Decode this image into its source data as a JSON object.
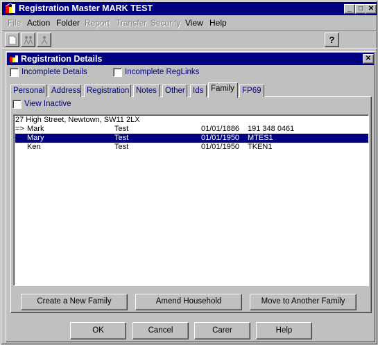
{
  "window": {
    "title": "Registration Master MARK TEST"
  },
  "menu": {
    "items": [
      "File",
      "Action",
      "Folder",
      "Report",
      "Transfer",
      "Security",
      "View",
      "Help"
    ]
  },
  "toolbar": {
    "icons": [
      "new-document-icon",
      "people-icon",
      "person-icon",
      "question-mark-icon"
    ]
  },
  "dialog": {
    "title": "Registration Details",
    "incomplete_details_label": "Incomplete Details",
    "incomplete_reglinks_label": "Incomplete RegLinks",
    "tabs": [
      "Personal",
      "Address",
      "Registration",
      "Notes",
      "Other",
      "Ids",
      "Family",
      "FP69"
    ],
    "active_tab": "Family",
    "view_inactive_label": "View Inactive",
    "family": {
      "address": "27 High Street, Newtown, SW11 2LX",
      "members": [
        {
          "marker": "=>",
          "first": "Mark",
          "last": "Test",
          "dob": "01/01/1886",
          "id": "191 348 0461",
          "selected": false
        },
        {
          "marker": "",
          "first": "Mary",
          "last": "Test",
          "dob": "01/01/1950",
          "id": "MTES1",
          "selected": true
        },
        {
          "marker": "",
          "first": "Ken",
          "last": "Test",
          "dob": "01/01/1950",
          "id": "TKEN1",
          "selected": false
        }
      ]
    },
    "buttons": {
      "create_family": "Create a New Family",
      "amend_household": "Amend Household",
      "move_family": "Move to Another Family",
      "ok": "OK",
      "cancel": "Cancel",
      "carer": "Carer",
      "help": "Help"
    }
  }
}
